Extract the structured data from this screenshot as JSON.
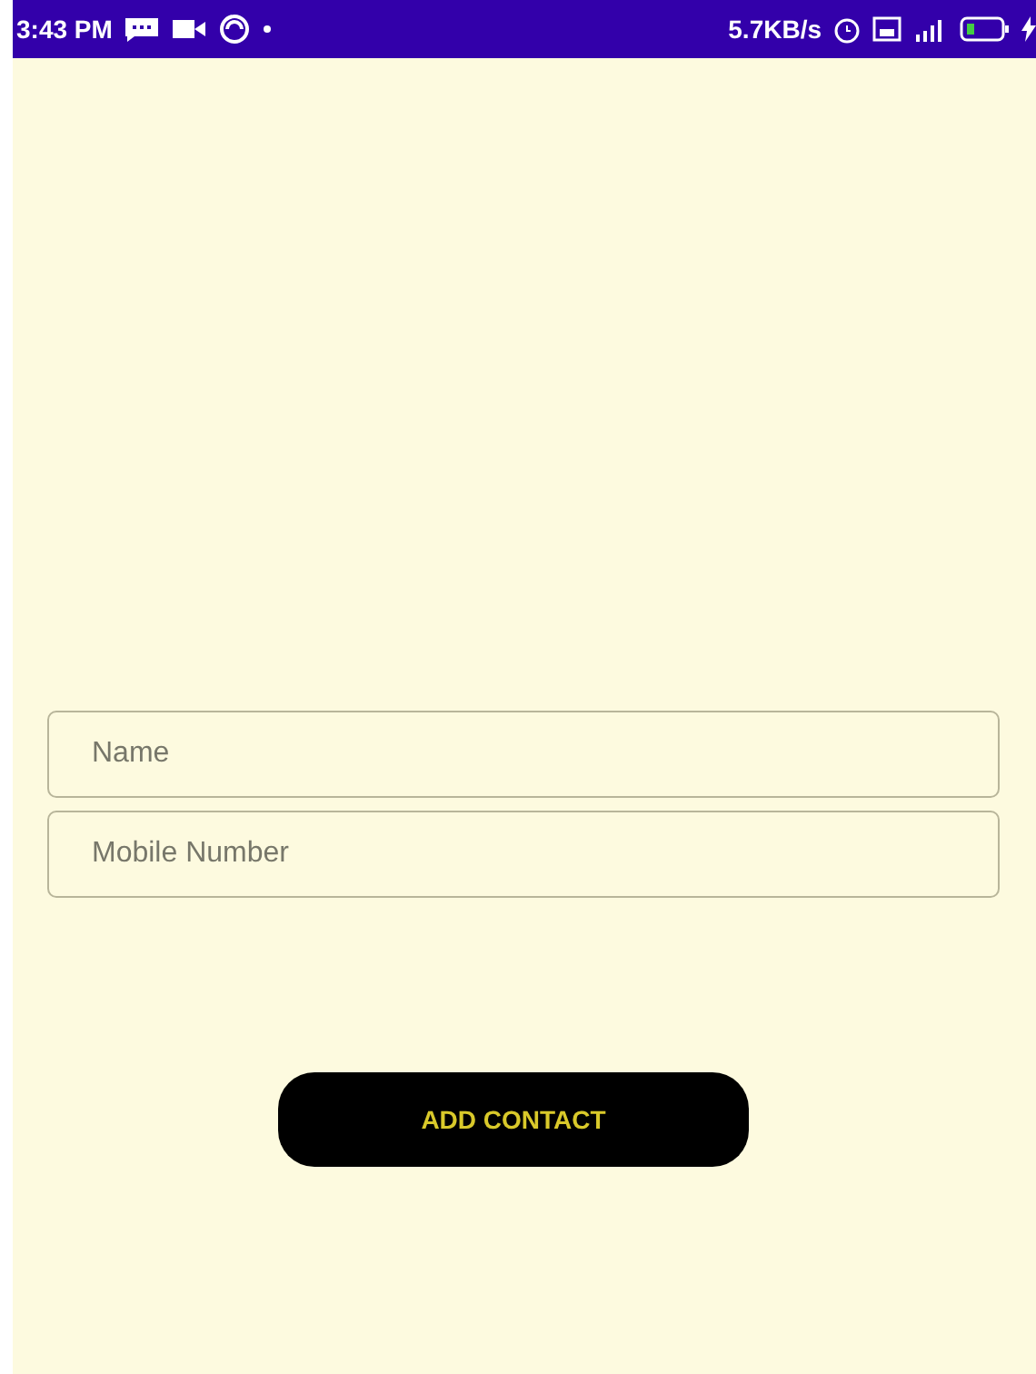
{
  "status_bar": {
    "time": "3:43 PM",
    "speed": "5.7KB/s"
  },
  "fields": [
    {
      "placeholder": "Name"
    },
    {
      "placeholder": "Mobile Number"
    }
  ],
  "button": {
    "label": "ADD CONTACT"
  }
}
